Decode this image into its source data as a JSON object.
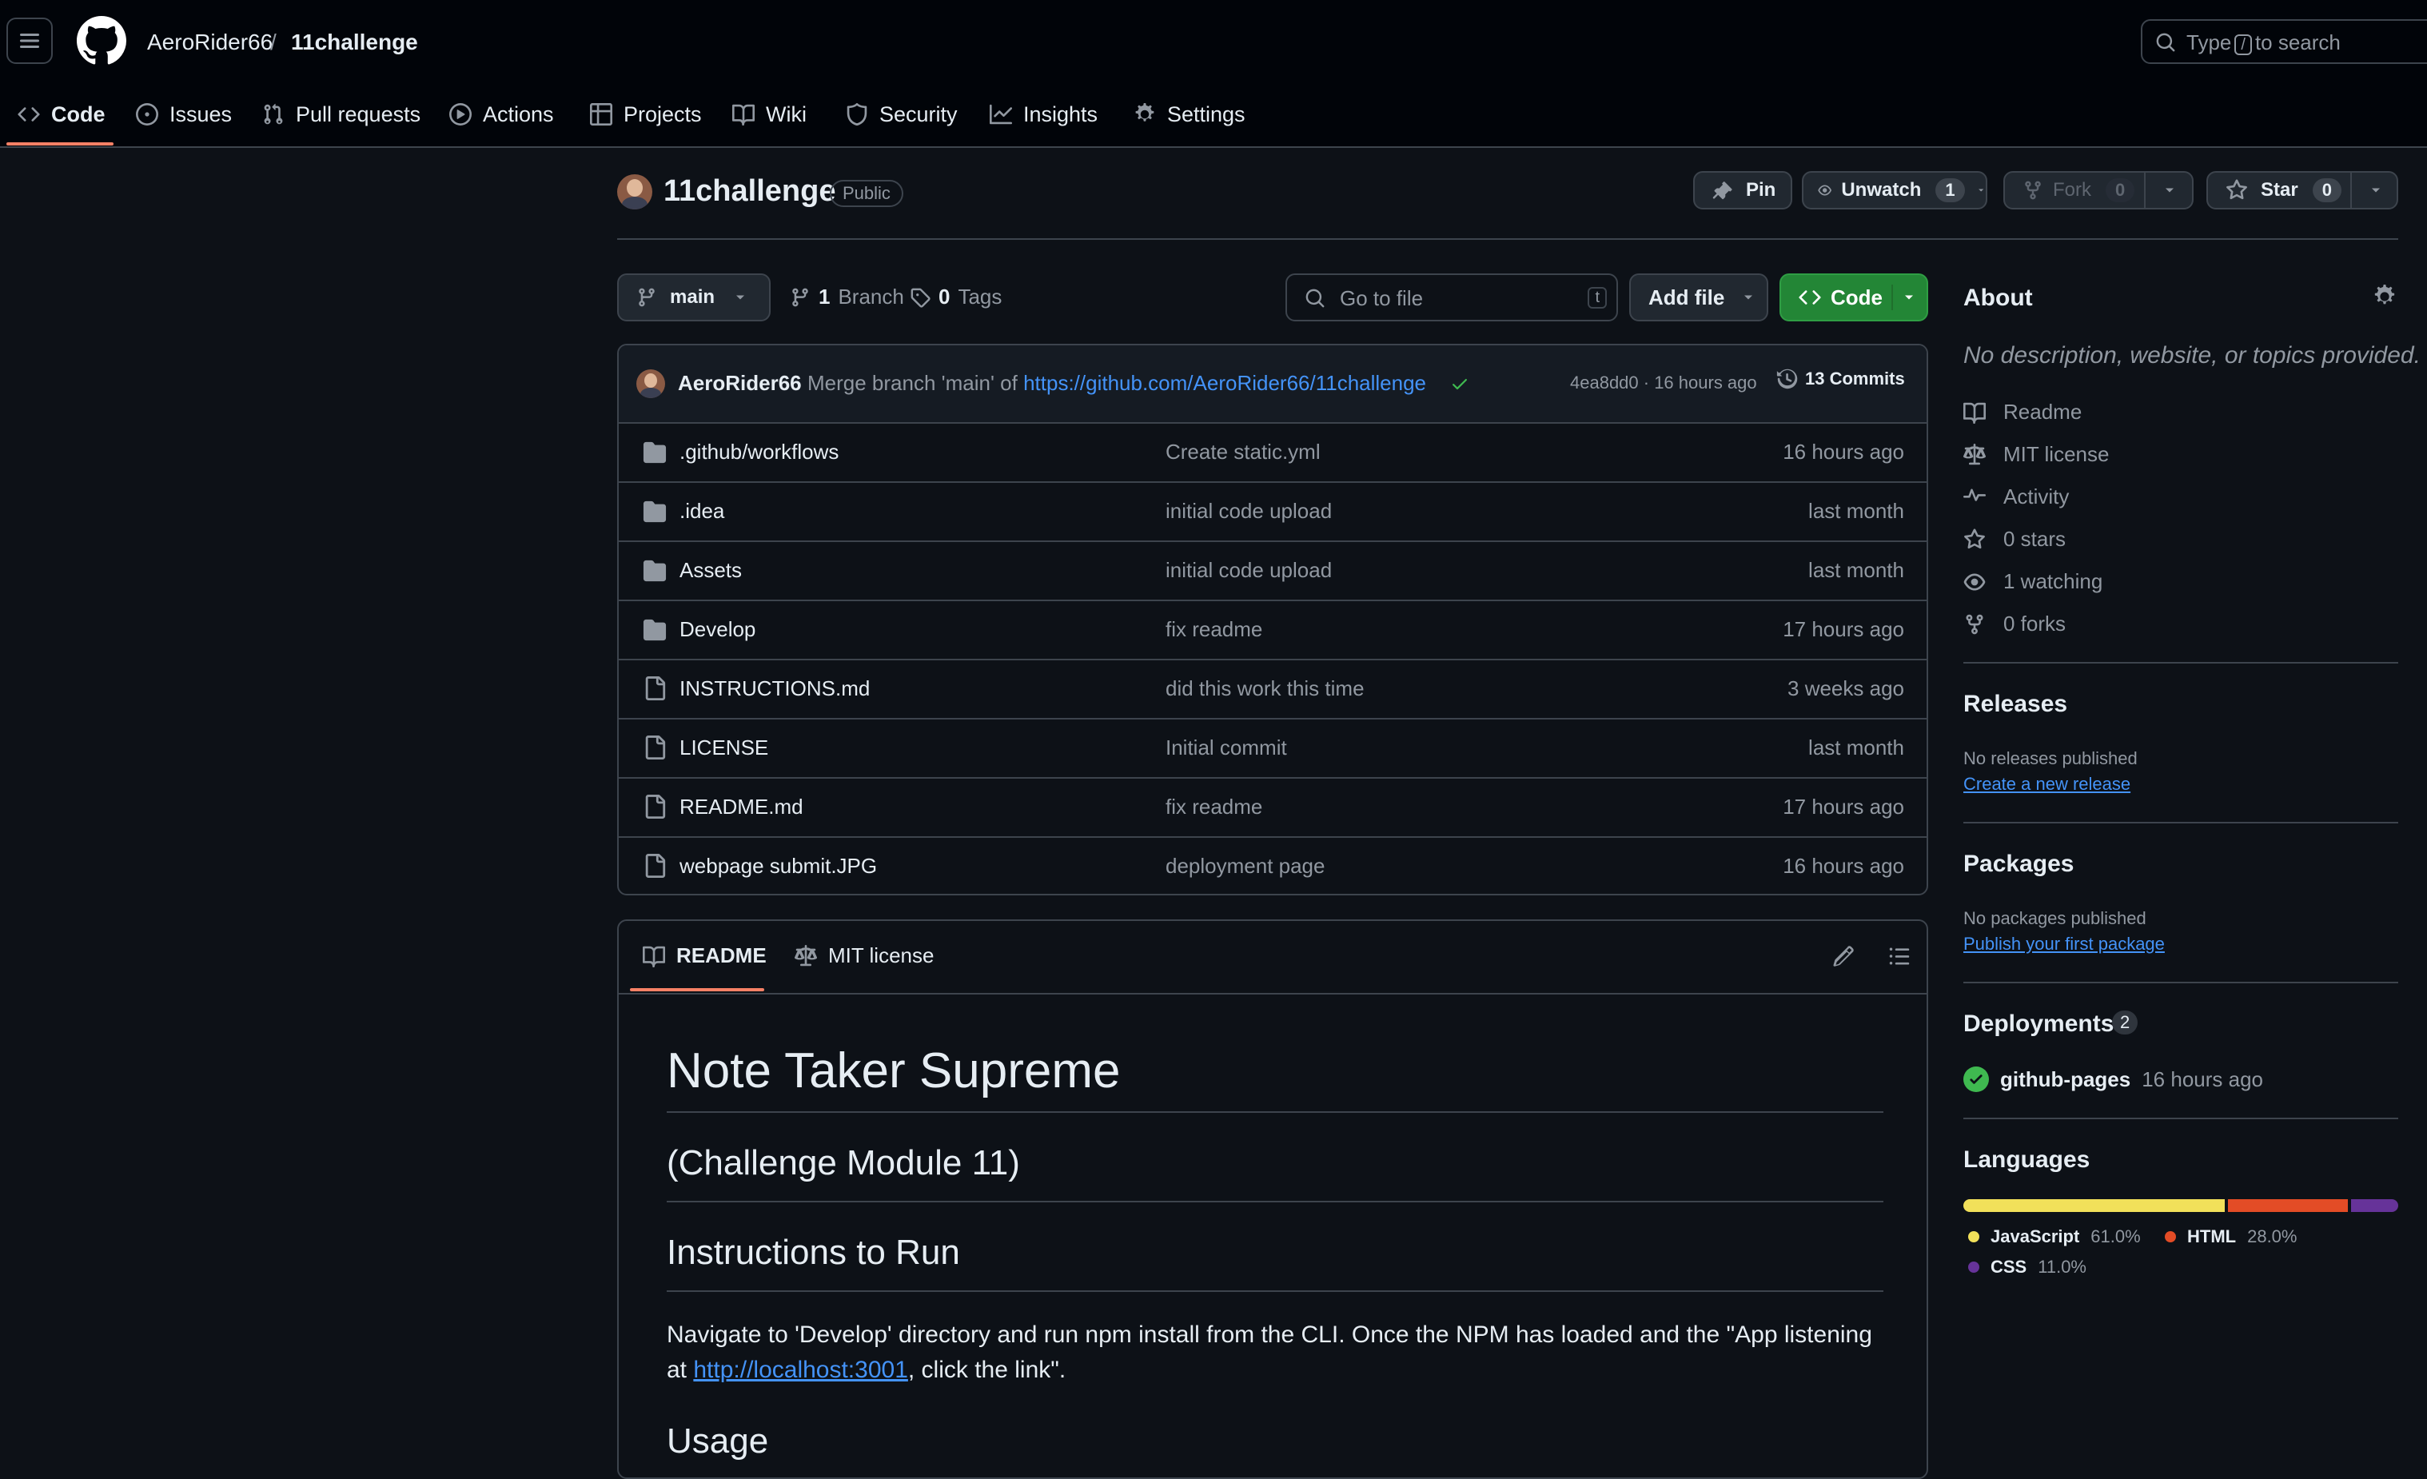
{
  "header": {
    "owner": "AeroRider66",
    "separator": "/",
    "repo": "11challenge",
    "search": {
      "pre": "Type",
      "key": "/",
      "post": "to search"
    },
    "tabs": [
      "Code",
      "Issues",
      "Pull requests",
      "Actions",
      "Projects",
      "Wiki",
      "Security",
      "Insights",
      "Settings"
    ]
  },
  "repo_head": {
    "name": "11challenge",
    "visibility": "Public",
    "pin": "Pin",
    "unwatch": "Unwatch",
    "unwatch_count": "1",
    "fork": "Fork",
    "fork_count": "0",
    "star": "Star",
    "star_count": "0"
  },
  "toolbar": {
    "branch": "main",
    "branches_num": "1",
    "branches_label": "Branch",
    "tags_num": "0",
    "tags_label": "Tags",
    "goto_placeholder": "Go to file",
    "goto_key": "t",
    "add_file": "Add file",
    "code": "Code"
  },
  "commit": {
    "author": "AeroRider66",
    "message": "Merge branch 'main' of",
    "link": "https://github.com/AeroRider66/11challenge",
    "meta": "4ea8dd0 · 16 hours ago",
    "commits": "13 Commits"
  },
  "files": [
    {
      "name": ".github/workflows",
      "msg": "Create static.yml",
      "age": "16 hours ago",
      "icon": "folder-icon"
    },
    {
      "name": ".idea",
      "msg": "initial code upload",
      "age": "last month",
      "icon": "folder-icon"
    },
    {
      "name": "Assets",
      "msg": "initial code upload",
      "age": "last month",
      "icon": "folder-icon"
    },
    {
      "name": "Develop",
      "msg": "fix readme",
      "age": "17 hours ago",
      "icon": "folder-icon"
    },
    {
      "name": "INSTRUCTIONS.md",
      "msg": "did this work this time",
      "age": "3 weeks ago",
      "icon": "file-icon"
    },
    {
      "name": "LICENSE",
      "msg": "Initial commit",
      "age": "last month",
      "icon": "file-icon"
    },
    {
      "name": "README.md",
      "msg": "fix readme",
      "age": "17 hours ago",
      "icon": "file-icon"
    },
    {
      "name": "webpage submit.JPG",
      "msg": "deployment page",
      "age": "16 hours ago",
      "icon": "file-icon"
    }
  ],
  "readme": {
    "tab_readme": "README",
    "tab_license": "MIT license",
    "h1": "Note Taker Supreme",
    "h2a": "(Challenge Module 11)",
    "h2b": "Instructions to Run",
    "p_pre": "Navigate to 'Develop' directory and run npm install from the CLI. Once the NPM has loaded and the \"App listening at ",
    "p_link": "http://localhost:3001",
    "p_post": ", click the link\".",
    "h2c": "Usage"
  },
  "about": {
    "title": "About",
    "desc": "No description, website, or topics provided.",
    "items": [
      "Readme",
      "MIT license",
      "Activity",
      "0 stars",
      "1 watching",
      "0 forks"
    ]
  },
  "releases": {
    "title": "Releases",
    "none": "No releases published",
    "link": "Create a new release"
  },
  "packages": {
    "title": "Packages",
    "none": "No packages published",
    "link": "Publish your first package"
  },
  "deployments": {
    "title": "Deployments",
    "count": "2",
    "name": "github-pages",
    "age": "16 hours ago",
    "status_color": "#3fb950"
  },
  "languages": {
    "title": "Languages",
    "items": [
      {
        "name": "JavaScript",
        "pct": "61.0%",
        "value": 61.0,
        "color": "#f1e05a"
      },
      {
        "name": "HTML",
        "pct": "28.0%",
        "value": 28.0,
        "color": "#e34c26"
      },
      {
        "name": "CSS",
        "pct": "11.0%",
        "value": 11.0,
        "color": "#663399"
      }
    ]
  }
}
